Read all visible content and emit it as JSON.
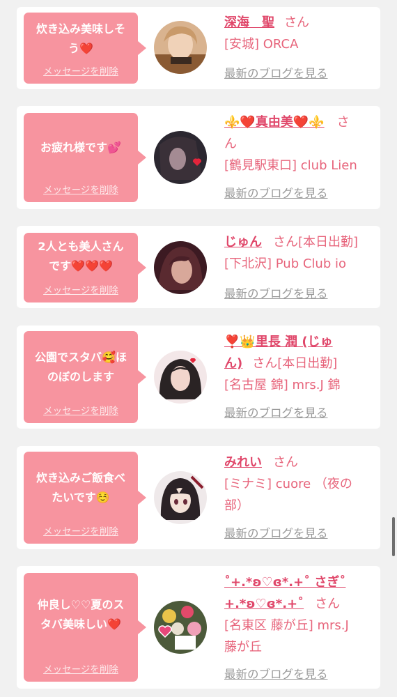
{
  "messages": [
    {
      "message_lines": [
        "炊き込み美味しそ",
        "う❤️"
      ],
      "delete_label": "メッセージを削除",
      "cast_name_lines": [
        "深海　聖"
      ],
      "honorific": "さん",
      "shop_lines": [
        "[安城] ORCA"
      ],
      "blog_label": "最新のブログを見る",
      "avatar_icon": "avatar-photo-icon"
    },
    {
      "message_lines": [
        "お疲れ様です💕"
      ],
      "delete_label": "メッセージを削除",
      "cast_name_lines": [
        "⚜️❤️真由美❤️⚜️"
      ],
      "honorific": "さ\nん",
      "shop_lines": [
        "[鶴見駅東口] club Lien"
      ],
      "blog_label": "最新のブログを見る",
      "avatar_icon": "avatar-photo-icon"
    },
    {
      "message_lines": [
        "2人とも美人さん",
        "です❤️❤️❤️"
      ],
      "delete_label": "メッセージを削除",
      "cast_name_lines": [
        "じゅん"
      ],
      "honorific": "さん[本日出勤]",
      "shop_lines": [
        "[下北沢] Pub Club io"
      ],
      "blog_label": "最新のブログを見る",
      "avatar_icon": "avatar-photo-icon"
    },
    {
      "message_lines": [
        "公園でスタバ🥰ほ",
        "のぼのします"
      ],
      "delete_label": "メッセージを削除",
      "cast_name_lines": [
        "❣️👑里長 潤 (じゅ",
        "ん)"
      ],
      "honorific": "さん[本日出勤]",
      "shop_lines": [
        "[名古屋 錦] mrs.J 錦"
      ],
      "blog_label": "最新のブログを見る",
      "avatar_icon": "avatar-photo-icon"
    },
    {
      "message_lines": [
        "炊き込みご飯食べ",
        "たいです☺️"
      ],
      "delete_label": "メッセージを削除",
      "cast_name_lines": [
        "みれい"
      ],
      "honorific": "さん",
      "shop_lines": [
        "[ミナミ] cuore （夜の",
        "部）"
      ],
      "blog_label": "最新のブログを見る",
      "avatar_icon": "avatar-anime-icon"
    },
    {
      "message_lines": [
        "仲良し♡♡夏のス",
        "タバ美味しい❤️"
      ],
      "delete_label": "メッセージを削除",
      "cast_name_lines": [
        "˚+.*ʚ♡ɞ*.+˚ さぎ˚",
        "+.*ʚ♡ɞ*.+˚"
      ],
      "honorific": "さん",
      "shop_lines": [
        "[名東区 藤が丘] mrs.J",
        "藤が丘"
      ],
      "blog_label": "最新のブログを見る",
      "avatar_icon": "avatar-flowers-icon"
    }
  ],
  "colors": {
    "bubble": "#f7949f",
    "name": "#e0476a",
    "shop": "#e7647b",
    "blog_link": "#9a9a9a",
    "page_bg": "#f1f1f1"
  }
}
